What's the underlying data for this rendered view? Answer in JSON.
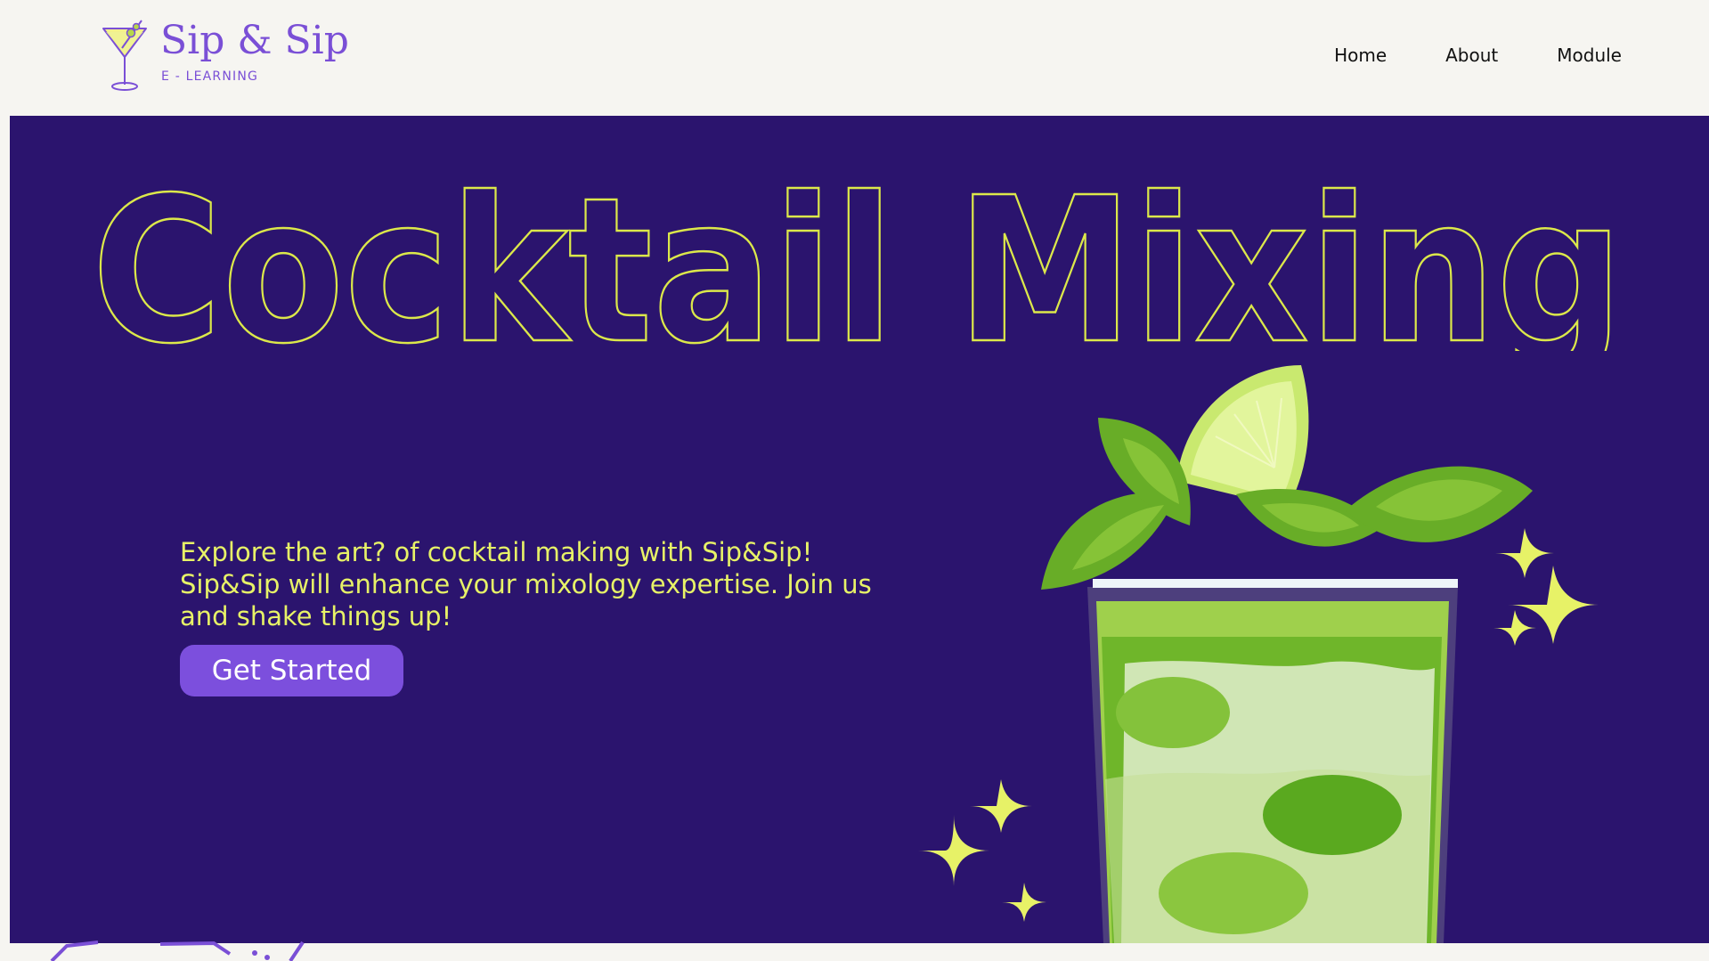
{
  "brand": {
    "name": "Sip & Sip",
    "subtitle": "E - LEARNING"
  },
  "nav": {
    "items": [
      {
        "label": "Home"
      },
      {
        "label": "About"
      },
      {
        "label": "Module"
      }
    ]
  },
  "hero": {
    "title": "Cocktail Mixing",
    "description": "Explore the art? of cocktail making with Sip&Sip! Sip&Sip will enhance your mixology expertise. Join us and shake things up!",
    "cta_label": "Get Started"
  },
  "colors": {
    "header_bg": "#f6f5f1",
    "hero_bg": "#2b146e",
    "accent_yellow": "#e7f267",
    "accent_purple": "#7c4fdd",
    "nav_text": "#111111"
  },
  "icons": [
    "cocktail-logo-icon",
    "sparkle-icon",
    "mojito-drink-image"
  ]
}
